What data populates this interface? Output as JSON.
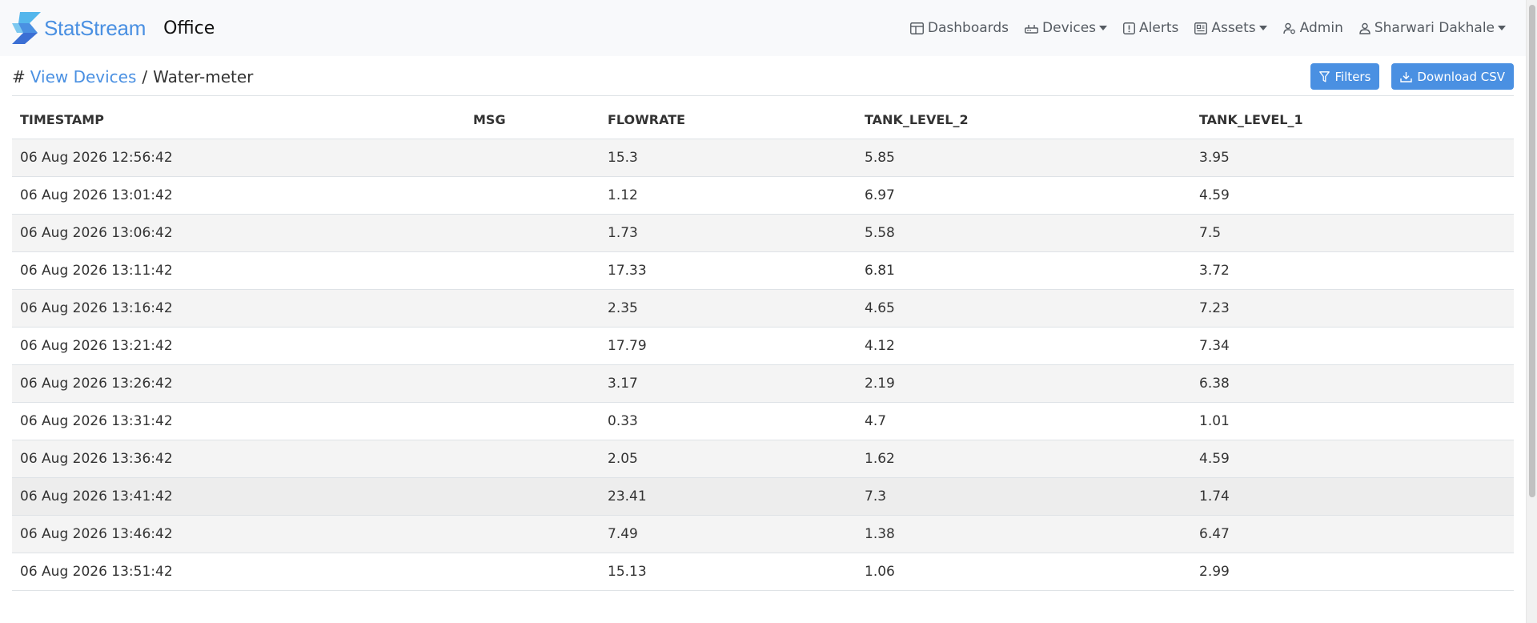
{
  "brand": {
    "name": "StatStream",
    "org": "Office",
    "colors": {
      "primary": "#4a90e2",
      "logo_light": "#54b6ec",
      "logo_dark": "#3b6fd4"
    }
  },
  "nav": {
    "dashboards": "Dashboards",
    "devices": "Devices",
    "alerts": "Alerts",
    "assets": "Assets",
    "admin": "Admin",
    "user": "Sharwari Dakhale"
  },
  "breadcrumb": {
    "hash": "#",
    "parent": "View Devices",
    "separator": "/",
    "current": "Water-meter"
  },
  "actions": {
    "filters": "Filters",
    "download": "Download CSV"
  },
  "table": {
    "columns": [
      "TIMESTAMP",
      "MSG",
      "FLOWRATE",
      "TANK_LEVEL_2",
      "TANK_LEVEL_1"
    ],
    "rows": [
      [
        "06 Aug 2026 12:56:42",
        "",
        "15.3",
        "5.85",
        "3.95"
      ],
      [
        "06 Aug 2026 13:01:42",
        "",
        "1.12",
        "6.97",
        "4.59"
      ],
      [
        "06 Aug 2026 13:06:42",
        "",
        "1.73",
        "5.58",
        "7.5"
      ],
      [
        "06 Aug 2026 13:11:42",
        "",
        "17.33",
        "6.81",
        "3.72"
      ],
      [
        "06 Aug 2026 13:16:42",
        "",
        "2.35",
        "4.65",
        "7.23"
      ],
      [
        "06 Aug 2026 13:21:42",
        "",
        "17.79",
        "4.12",
        "7.34"
      ],
      [
        "06 Aug 2026 13:26:42",
        "",
        "3.17",
        "2.19",
        "6.38"
      ],
      [
        "06 Aug 2026 13:31:42",
        "",
        "0.33",
        "4.7",
        "1.01"
      ],
      [
        "06 Aug 2026 13:36:42",
        "",
        "2.05",
        "1.62",
        "4.59"
      ],
      [
        "06 Aug 2026 13:41:42",
        "",
        "23.41",
        "7.3",
        "1.74"
      ],
      [
        "06 Aug 2026 13:46:42",
        "",
        "7.49",
        "1.38",
        "6.47"
      ],
      [
        "06 Aug 2026 13:51:42",
        "",
        "15.13",
        "1.06",
        "2.99"
      ]
    ]
  }
}
